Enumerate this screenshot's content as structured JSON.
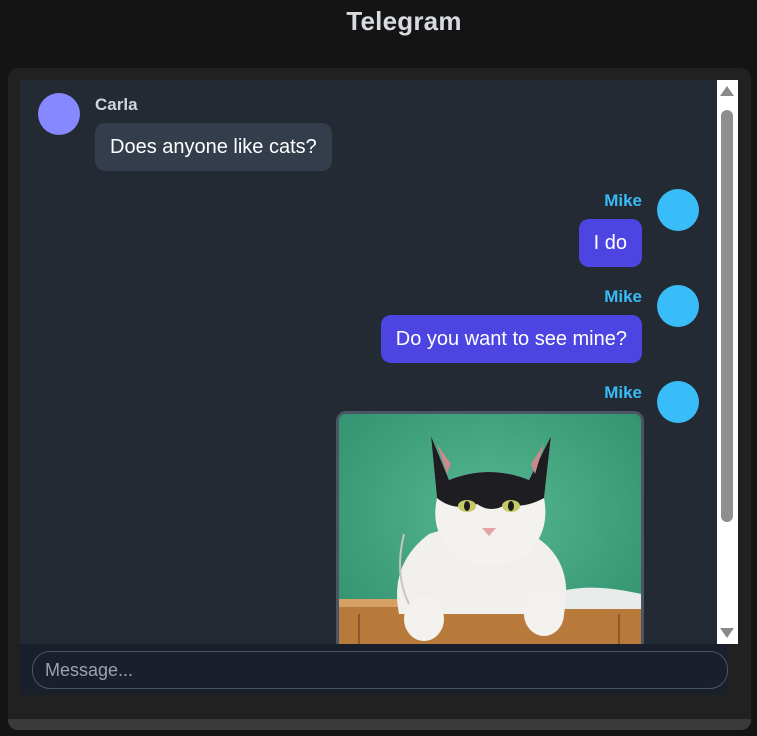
{
  "app": {
    "title": "Telegram"
  },
  "colors": {
    "background": "#141414",
    "chat_background": "#232a34",
    "incoming_bubble": "#343d4b",
    "outgoing_bubble": "#4d45e1",
    "carla_avatar": "#8588ff",
    "mike_avatar": "#38bdf8",
    "mike_name": "#38bdf8",
    "carla_name": "#d1d5db"
  },
  "messages": [
    {
      "sender": "Carla",
      "text": "Does anyone like cats?",
      "direction": "incoming"
    },
    {
      "sender": "Mike",
      "text": "I do",
      "direction": "outgoing"
    },
    {
      "sender": "Mike",
      "text": "Do you want to see mine?",
      "direction": "outgoing"
    },
    {
      "sender": "Mike",
      "text": "",
      "direction": "outgoing",
      "attachment": "cat-photo"
    }
  ],
  "composer": {
    "placeholder": "Message..."
  }
}
